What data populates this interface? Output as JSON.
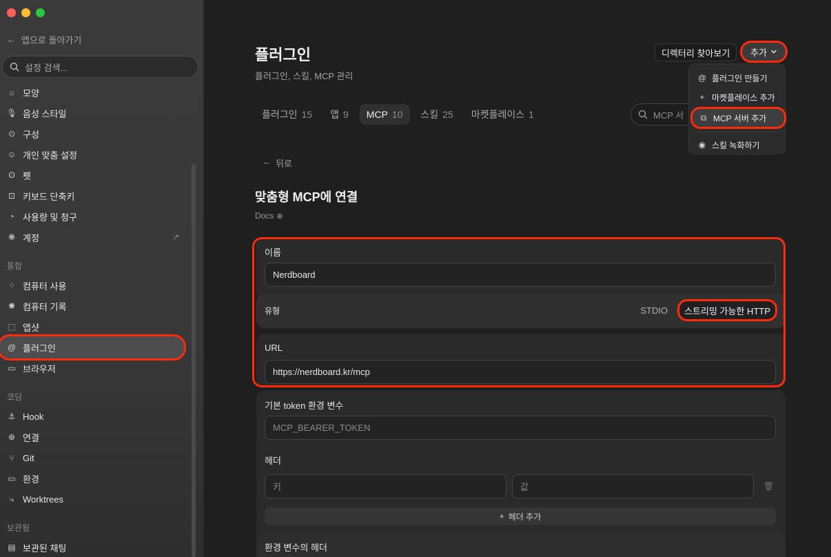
{
  "window": {
    "traffic_lights": [
      "close",
      "minimize",
      "zoom"
    ]
  },
  "sidebar": {
    "back_label": "앱으로 돌아가기",
    "search_placeholder": "설정 검색...",
    "items": [
      {
        "label": "모양",
        "icon": "sun-icon"
      },
      {
        "label": "음성 스타일",
        "icon": "mic-icon"
      },
      {
        "label": "구성",
        "icon": "config-icon"
      },
      {
        "label": "개인 맞춤 설정",
        "icon": "smile-icon"
      },
      {
        "label": "펫",
        "icon": "pet-icon"
      },
      {
        "label": "키보드 단축키",
        "icon": "keyboard-icon"
      },
      {
        "label": "사용량 및 청구",
        "icon": "gauge-icon"
      },
      {
        "label": "계정",
        "icon": "account-icon",
        "external": "↗"
      }
    ],
    "section_integration": "통합",
    "integration_items": [
      {
        "label": "컴퓨터 사용",
        "icon": "cursor-icon"
      },
      {
        "label": "컴퓨터 기록",
        "icon": "spark-icon"
      },
      {
        "label": "앱샷",
        "icon": "capture-icon"
      },
      {
        "label": "플러그인",
        "icon": "at-icon"
      },
      {
        "label": "브라우저",
        "icon": "browser-icon"
      }
    ],
    "section_coding": "코딩",
    "coding_items": [
      {
        "label": "Hook",
        "icon": "anchor-icon"
      },
      {
        "label": "연결",
        "icon": "globe-icon"
      },
      {
        "label": "Git",
        "icon": "git-icon"
      },
      {
        "label": "환경",
        "icon": "monitor-icon"
      },
      {
        "label": "Worktrees",
        "icon": "worktree-icon"
      }
    ],
    "section_archived": "보관됨",
    "archived_items": [
      {
        "label": "보관된 채팅",
        "icon": "archive-icon"
      }
    ]
  },
  "header": {
    "title": "플러그인",
    "subtitle": "플러그인, 스킬, MCP 관리",
    "directory_button": "디렉터리 찾아보기",
    "add_button": "추가"
  },
  "tabs": [
    {
      "label": "플러그인",
      "count": "15"
    },
    {
      "label": "앱",
      "count": "9"
    },
    {
      "label": "MCP",
      "count": "10"
    },
    {
      "label": "스킬",
      "count": "25"
    },
    {
      "label": "마켓플레이스",
      "count": "1"
    }
  ],
  "tab_search_placeholder": "MCP 서",
  "dropdown": {
    "items": [
      {
        "label": "플러그인 만들기",
        "icon": "at-icon"
      },
      {
        "label": "마켓플레이스 추가",
        "icon": "plus-icon"
      },
      {
        "label": "MCP 서버 추가",
        "icon": "mcp-icon"
      },
      {
        "label": "스킬 녹화하기",
        "icon": "record-icon"
      }
    ]
  },
  "content": {
    "back_label": "뒤로",
    "title": "맞춤형 MCP에 연결",
    "docs_label": "Docs"
  },
  "form": {
    "name_label": "이름",
    "name_value": "Nerdboard",
    "type_label": "유형",
    "type_options": [
      "STDIO",
      "스트리밍 가능한 HTTP"
    ],
    "url_label": "URL",
    "url_value": "https://nerdboard.kr/mcp",
    "token_label": "기본 token 환경 변수",
    "token_placeholder": "MCP_BEARER_TOKEN",
    "headers_label": "헤더",
    "header_key_placeholder": "키",
    "header_value_placeholder": "값",
    "add_header_label": "헤더 추가",
    "env_headers_label": "환경 변수의 헤더"
  },
  "colors": {
    "highlight": "#ff2a0a",
    "background": "#1f1f1f",
    "sidebar": "#383838"
  }
}
